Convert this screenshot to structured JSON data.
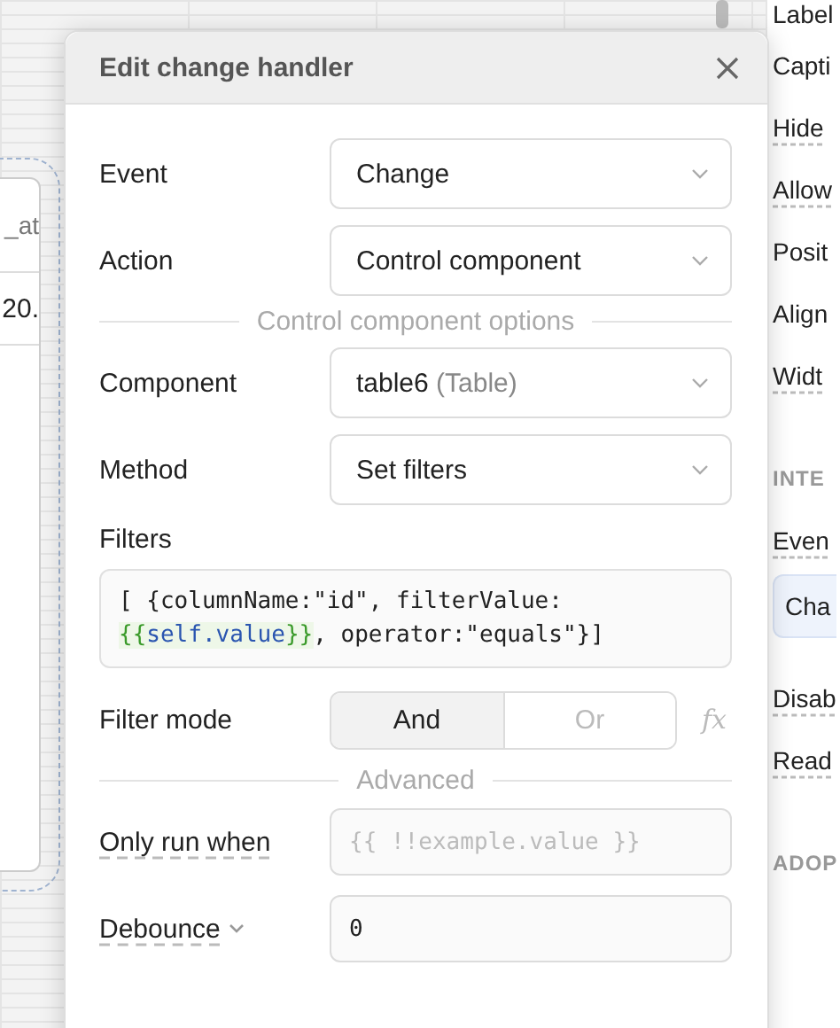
{
  "canvas": {
    "table": {
      "column_header": "_at",
      "cell": "20."
    }
  },
  "inspector": {
    "items": [
      {
        "kind": "label",
        "text": "Label",
        "tooltip": false
      },
      {
        "kind": "label",
        "text": "Capti",
        "tooltip": false
      },
      {
        "kind": "label",
        "text": "Hide",
        "tooltip": true
      },
      {
        "kind": "label",
        "text": "Allow",
        "tooltip": true
      },
      {
        "kind": "label",
        "text": "Posit",
        "tooltip": false
      },
      {
        "kind": "label",
        "text": "Align",
        "tooltip": false
      },
      {
        "kind": "label",
        "text": "Widt",
        "tooltip": true
      },
      {
        "kind": "section",
        "text": "INTE",
        "tooltip": false
      },
      {
        "kind": "label",
        "text": "Even",
        "tooltip": true
      },
      {
        "kind": "button",
        "text": "Cha",
        "tooltip": false
      },
      {
        "kind": "label",
        "text": "Disab",
        "tooltip": true
      },
      {
        "kind": "label",
        "text": "Read",
        "tooltip": true
      },
      {
        "kind": "section",
        "text": "ADOP",
        "tooltip": false
      }
    ]
  },
  "modal": {
    "title": "Edit change handler",
    "fields": [
      {
        "kind": "select",
        "label": "Event",
        "value": "Change"
      },
      {
        "kind": "select",
        "label": "Action",
        "value": "Control component"
      },
      {
        "kind": "divider",
        "text": "Control component options"
      },
      {
        "kind": "select",
        "label": "Component",
        "value": "table6",
        "hint": "(Table)"
      },
      {
        "kind": "select",
        "label": "Method",
        "value": "Set filters"
      },
      {
        "kind": "code",
        "label": "Filters",
        "segments": [
          {
            "kind": "plain",
            "text": "[ {columnName:\"id\", filterValue: "
          },
          {
            "kind": "brace",
            "text": "{{"
          },
          {
            "kind": "ref",
            "text": "self.value"
          },
          {
            "kind": "brace",
            "text": "}}"
          },
          {
            "kind": "plain",
            "text": ", operator:\"equals\"}]"
          }
        ]
      },
      {
        "kind": "toggle",
        "label": "Filter mode",
        "formula_button": "fx",
        "options": [
          {
            "label": "And",
            "selected": true
          },
          {
            "label": "Or",
            "selected": false
          }
        ]
      },
      {
        "kind": "divider",
        "text": "Advanced"
      },
      {
        "kind": "input",
        "label": "Only run when",
        "tooltip": true,
        "placeholder": "{{ !!example.value }}"
      },
      {
        "kind": "input",
        "label": "Debounce",
        "tooltip": true,
        "has_caret": true,
        "value": "0"
      }
    ]
  }
}
